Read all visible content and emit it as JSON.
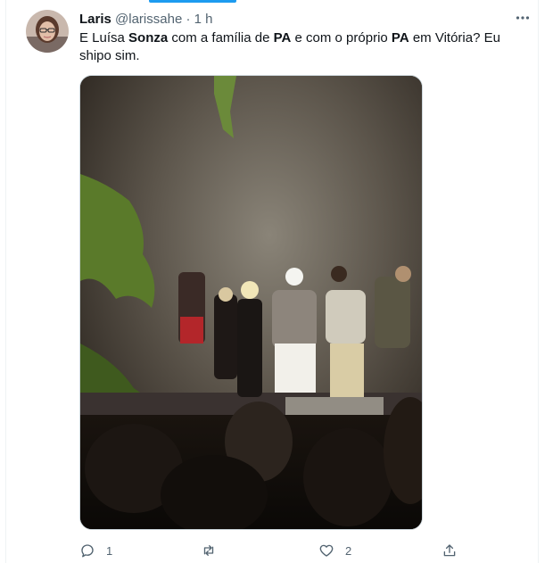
{
  "tweet": {
    "author_name": "Laris",
    "handle": "@larissahe",
    "separator": " · ",
    "time": "1 h",
    "text_parts": [
      {
        "t": "E Luísa ",
        "bold": false
      },
      {
        "t": "Sonza",
        "bold": true
      },
      {
        "t": " com a família de ",
        "bold": false
      },
      {
        "t": "PA",
        "bold": true
      },
      {
        "t": " e com o próprio ",
        "bold": false
      },
      {
        "t": "PA",
        "bold": true
      },
      {
        "t": " em Vitória? Eu shipo sim.",
        "bold": false
      }
    ]
  },
  "actions": {
    "reply_count": "1",
    "retweet_count": "",
    "like_count": "2"
  },
  "icons": {
    "more": "more-horizontal-icon",
    "reply": "reply-icon",
    "retweet": "retweet-icon",
    "like": "heart-icon",
    "share": "share-icon"
  },
  "colors": {
    "accent": "#1d9bf0",
    "text": "#0f1419",
    "secondary": "#536471"
  }
}
